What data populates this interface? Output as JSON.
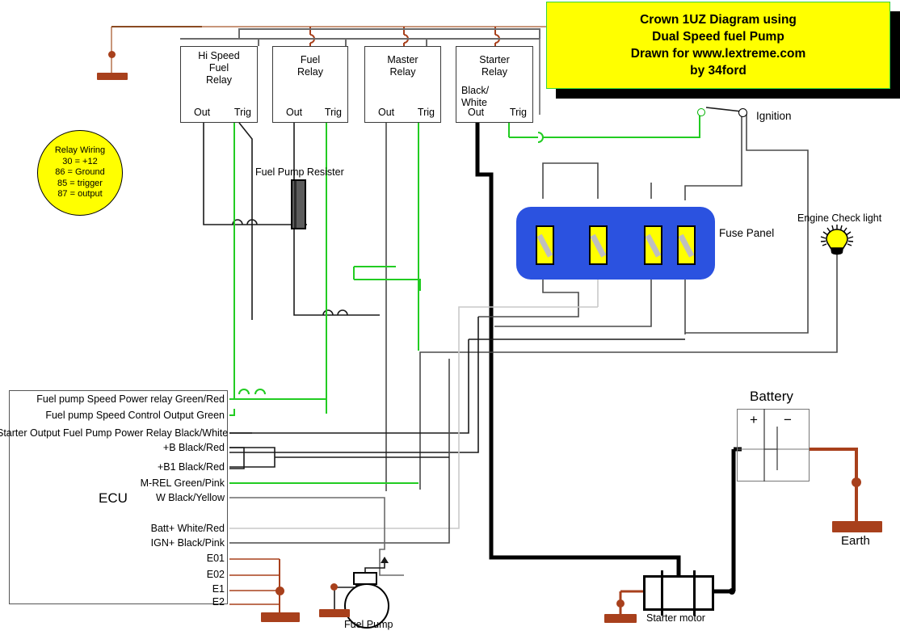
{
  "title_card": {
    "lines": [
      "Crown 1UZ Diagram using",
      "Dual Speed fuel Pump",
      "Drawn for www.lextreme.com",
      "by 34ford"
    ],
    "background": "#ffff00",
    "border": "#37d437"
  },
  "legend": {
    "lines": [
      "Relay Wiring",
      "30 = +12",
      "86 = Ground",
      "85 = trigger",
      "87 = output"
    ],
    "background": "#ffff00"
  },
  "relays": [
    {
      "name": "Hi Speed\nFuel\nRelay",
      "name_lines": [
        "Hi Speed",
        "Fuel",
        "Relay"
      ],
      "out": "Out",
      "trig": "Trig",
      "extra": ""
    },
    {
      "name": "Fuel Relay",
      "name_lines": [
        "Fuel",
        "Relay"
      ],
      "out": "Out",
      "trig": "Trig",
      "extra": ""
    },
    {
      "name": "Master Relay",
      "name_lines": [
        "Master",
        "Relay"
      ],
      "out": "Out",
      "trig": "Trig",
      "extra": ""
    },
    {
      "name": "Starter Relay",
      "name_lines": [
        "Starter",
        "Relay"
      ],
      "out": "Out",
      "trig": "Trig",
      "extra_lines": [
        "Black/",
        "White"
      ]
    }
  ],
  "components": {
    "resistor_label": "Fuel Pump Resister",
    "fuse_panel_label": "Fuse Panel",
    "ignition_label": "Ignition",
    "engine_check_label": "Engine Check light",
    "battery_label": "Battery",
    "battery_plus": "+",
    "battery_minus": "−",
    "earth_label": "Earth",
    "fuel_pump_label": "Fuel Pump",
    "starter_motor_label": "Starter motor",
    "ecu_label": "ECU"
  },
  "ecu_pins": [
    "Fuel pump Speed Power relay Green/Red",
    "Fuel pump Speed Control Output Green",
    "Starter Output Fuel Pump Power Relay Black/White",
    "+B Black/Red",
    "+B1 Black/Red",
    "M-REL Green/Pink",
    "W Black/Yellow",
    "Batt+ White/Red",
    "IGN+ Black/Pink",
    "E01",
    "E02",
    "E1",
    "E2"
  ],
  "colors": {
    "wire_green": "#22cc22",
    "wire_brown": "#a8401c",
    "wire_black": "#000000",
    "wire_gray": "#555555",
    "wire_lightgray": "#cccccc",
    "fuse_panel_blue": "#2b52e0",
    "fuse_yellow": "#ffff00",
    "highlight_yellow": "#ffff00"
  }
}
